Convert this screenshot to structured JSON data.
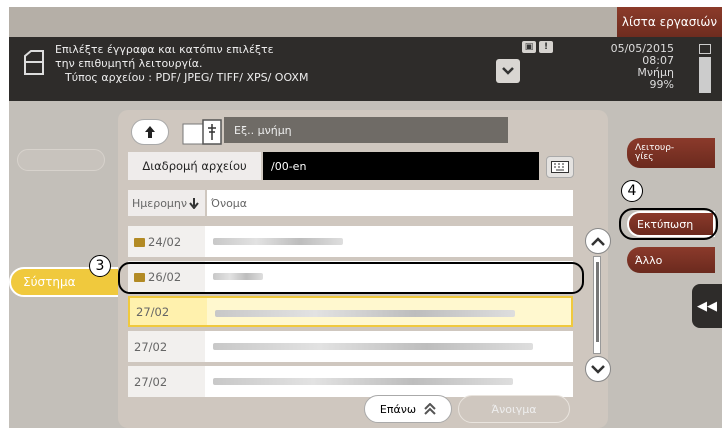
{
  "header": {
    "joblist_label": "λίστα εργασιών",
    "instruction_line1": "Επιλέξτε έγγραφα και κατόπιν επιλέξτε",
    "instruction_line2": "την επιθυμητή λειτουργία.",
    "file_type": "Τύπος αρχείου    : PDF/ JPEG/ TIFF/ XPS/ OOXM",
    "date": "05/05/2015",
    "time": "08:07",
    "memory_label": "Μνήμη",
    "memory_value": "99%",
    "memory_fraction": 0.99
  },
  "left": {
    "system_label": "Σύστημα"
  },
  "nav": {
    "up_icon": "up-arrow-icon",
    "source_label": "Εξ.. μνήμη"
  },
  "path": {
    "label": "Διαδρομή αρχείου",
    "value": "/00-en"
  },
  "sort": {
    "date_header": "Ημερομην",
    "name_header": "Όνομα"
  },
  "files": [
    {
      "date": "24/02",
      "folder": true
    },
    {
      "date": "26/02",
      "folder": true
    },
    {
      "date": "27/02",
      "folder": false
    },
    {
      "date": "27/02",
      "folder": false
    },
    {
      "date": "27/02",
      "folder": false
    }
  ],
  "bottom": {
    "top_label": "Επάνω",
    "open_label": "Άνοιγμα"
  },
  "right": {
    "functions_label": "Λειτουρ-\nγίες",
    "print_label": "Εκτύπωση",
    "other_label": "Άλλο"
  },
  "callouts": {
    "three": "3",
    "four": "4"
  },
  "colors": {
    "accent_yellow": "#f0c93d",
    "maroon": "#7a3225",
    "dark_header": "#2e2c2a"
  }
}
